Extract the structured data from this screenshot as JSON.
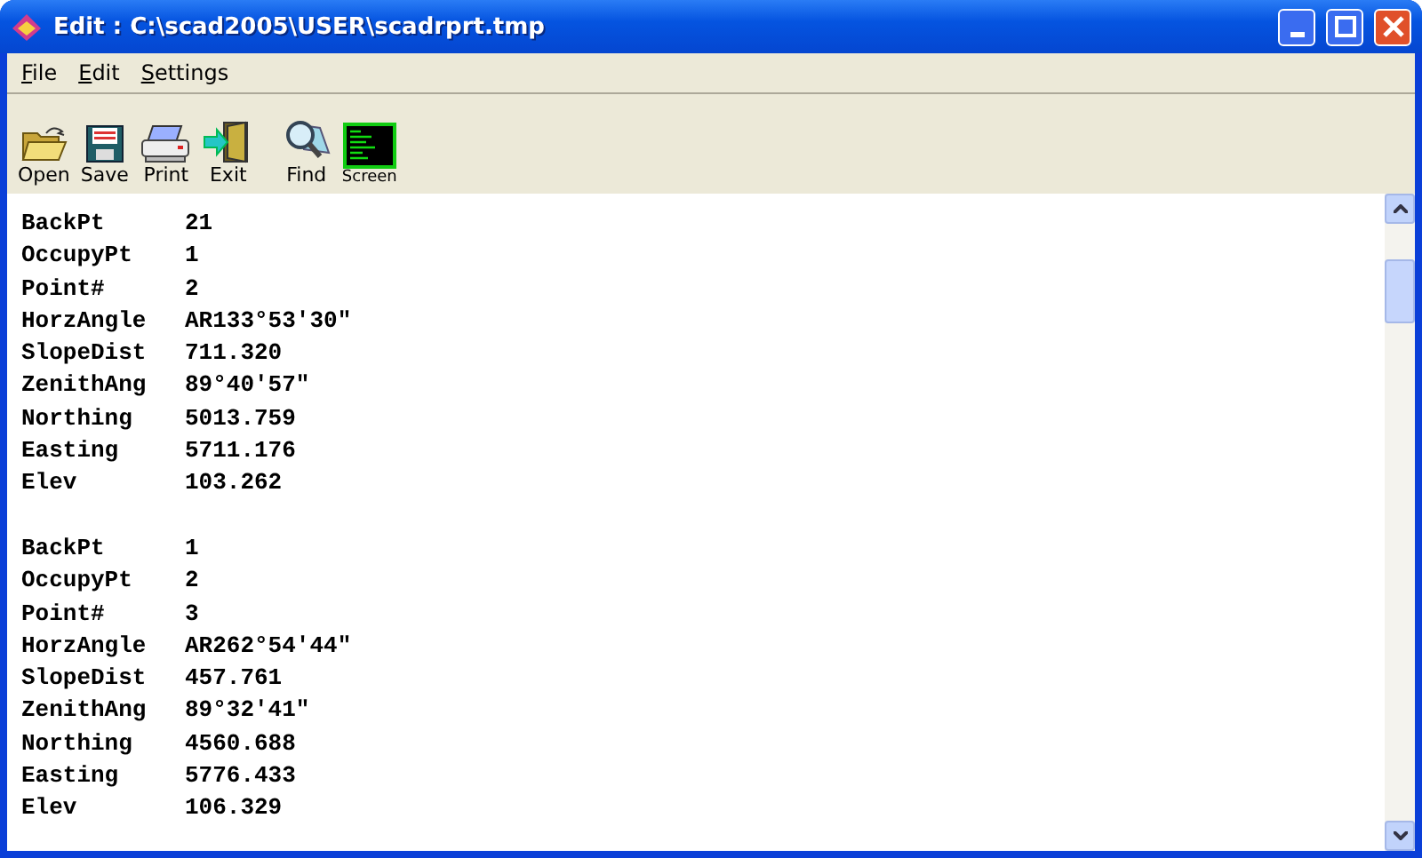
{
  "window": {
    "title": "Edit : C:\\scad2005\\USER\\scadrprt.tmp"
  },
  "menu": [
    "File",
    "Edit",
    "Settings"
  ],
  "toolbar": [
    {
      "kind": "open",
      "label": "Open"
    },
    {
      "kind": "save",
      "label": "Save"
    },
    {
      "kind": "print",
      "label": "Print"
    },
    {
      "kind": "exit",
      "label": "Exit"
    },
    {
      "kind": "find",
      "label": "Find"
    },
    {
      "kind": "screen",
      "label": "Screen"
    }
  ],
  "records": [
    [
      {
        "label": "BackPt",
        "value": "21"
      },
      {
        "label": "OccupyPt",
        "value": "1"
      },
      {
        "label": "Point#",
        "value": "2"
      },
      {
        "label": "HorzAngle",
        "value": "AR133°53'30\""
      },
      {
        "label": "SlopeDist",
        "value": "711.320"
      },
      {
        "label": "ZenithAng",
        "value": "89°40'57\""
      },
      {
        "label": "Northing",
        "value": "5013.759"
      },
      {
        "label": "Easting",
        "value": "5711.176"
      },
      {
        "label": "Elev",
        "value": "103.262"
      }
    ],
    [
      {
        "label": "BackPt",
        "value": "1"
      },
      {
        "label": "OccupyPt",
        "value": "2"
      },
      {
        "label": "Point#",
        "value": "3"
      },
      {
        "label": "HorzAngle",
        "value": "AR262°54'44\""
      },
      {
        "label": "SlopeDist",
        "value": "457.761"
      },
      {
        "label": "ZenithAng",
        "value": "89°32'41\""
      },
      {
        "label": "Northing",
        "value": "4560.688"
      },
      {
        "label": "Easting",
        "value": "5776.433"
      },
      {
        "label": "Elev",
        "value": "106.329"
      }
    ]
  ]
}
